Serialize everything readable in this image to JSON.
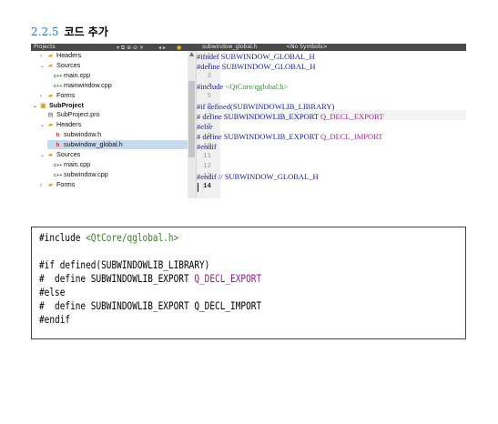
{
  "heading": {
    "number": "2.2.5",
    "title": "코드 추가"
  },
  "toolbar": {
    "projects_label": "Projects",
    "file_label": "subwindow_global.h",
    "symbols_label": "<No Symbols>"
  },
  "tree": {
    "items": [
      {
        "label": "Headers",
        "icon": "folder-icon",
        "arrow": ">"
      },
      {
        "label": "Sources",
        "icon": "folder-icon",
        "arrow": "v"
      },
      {
        "label": "main.cpp",
        "icon": "cpp-file-icon",
        "arrow": ""
      },
      {
        "label": "mainwindow.cpp",
        "icon": "cpp-file-icon",
        "arrow": ""
      },
      {
        "label": "Forms",
        "icon": "folder-icon",
        "arrow": ">"
      },
      {
        "label": "SubProject",
        "icon": "project-icon",
        "arrow": "v"
      },
      {
        "label": "SubProject.pro",
        "icon": "pro-file-icon",
        "arrow": ""
      },
      {
        "label": "Headers",
        "icon": "folder-icon",
        "arrow": "v"
      },
      {
        "label": "subwindow.h",
        "icon": "header-file-icon",
        "arrow": ""
      },
      {
        "label": "subwindow_global.h",
        "icon": "header-file-icon",
        "arrow": "",
        "selected": true
      },
      {
        "label": "Sources",
        "icon": "folder-icon",
        "arrow": "v"
      },
      {
        "label": "main.cpp",
        "icon": "cpp-file-icon",
        "arrow": ""
      },
      {
        "label": "subwindow.cpp",
        "icon": "cpp-file-icon",
        "arrow": ""
      },
      {
        "label": "Forms",
        "icon": "folder-icon",
        "arrow": ">"
      }
    ]
  },
  "editor": {
    "line_numbers": [
      "1",
      "2",
      "3",
      "4",
      "5",
      "6",
      "7",
      "8",
      "9",
      "10",
      "11",
      "12",
      "13",
      "14"
    ],
    "lines": {
      "l1": "#ifndef SUBWINDOW_GLOBAL_H",
      "l2": "#define SUBWINDOW_GLOBAL_H",
      "l4a": "#include ",
      "l4b": "<QtCore/qglobal.h>",
      "l6": "#if defined(SUBWINDOWLIB_LIBRARY)",
      "l7a": "#  define SUBWINDOWLIB_EXPORT ",
      "l7b": "Q_DECL_EXPORT",
      "l8": "#else",
      "l9a": "#  define SUBWINDOWLIB_EXPORT ",
      "l9b": "Q_DECL_IMPORT",
      "l10": "#endif",
      "l13": "#endif // SUBWINDOW_GLOBAL_H"
    }
  },
  "snippet": {
    "l1a": "#include ",
    "l1b": "<QtCore/qglobal.h>",
    "l3": "#if defined(SUBWINDOWLIB_LIBRARY)",
    "l4a": "#  define SUBWINDOWLIB_EXPORT ",
    "l4b": "Q_DECL_EXPORT",
    "l5": "#else",
    "l6": "#  define SUBWINDOWLIB_EXPORT Q_DECL_IMPORT",
    "l7": "#endif"
  }
}
